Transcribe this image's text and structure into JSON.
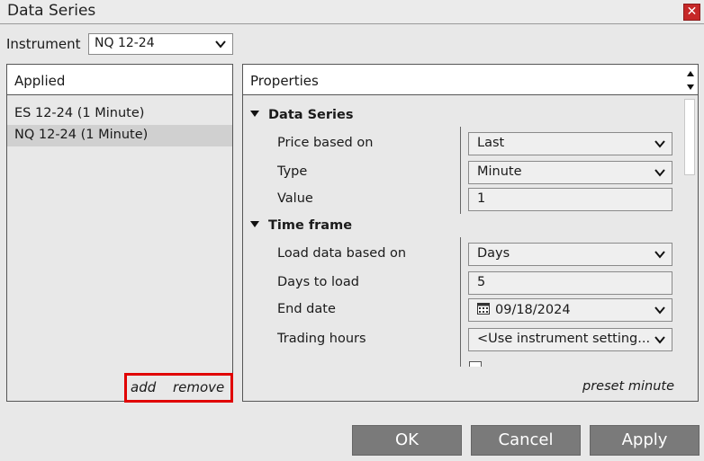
{
  "window": {
    "title": "Data Series"
  },
  "instrument": {
    "label": "Instrument",
    "value": "NQ 12-24"
  },
  "applied": {
    "header": "Applied",
    "items": [
      {
        "label": "ES 12-24 (1 Minute)",
        "selected": false
      },
      {
        "label": "NQ 12-24 (1 Minute)",
        "selected": true
      }
    ],
    "add_label": "add",
    "remove_label": "remove"
  },
  "properties": {
    "header": "Properties",
    "categories": [
      {
        "name": "Data Series",
        "rows": [
          {
            "label": "Price based on",
            "value": "Last",
            "kind": "dropdown"
          },
          {
            "label": "Type",
            "value": "Minute",
            "kind": "dropdown"
          },
          {
            "label": "Value",
            "value": "1",
            "kind": "text"
          }
        ]
      },
      {
        "name": "Time frame",
        "rows": [
          {
            "label": "Load data based on",
            "value": "Days",
            "kind": "dropdown"
          },
          {
            "label": "Days to load",
            "value": "5",
            "kind": "text"
          },
          {
            "label": "End date",
            "value": "09/18/2024",
            "kind": "date"
          },
          {
            "label": "Trading hours",
            "value": "<Use instrument setting...",
            "kind": "dropdown"
          }
        ]
      }
    ],
    "preset_label": "preset minute"
  },
  "buttons": {
    "ok": "OK",
    "cancel": "Cancel",
    "apply": "Apply"
  },
  "colors": {
    "close": "#c62828",
    "highlight_border": "#e00000",
    "button_bg": "#7a7a7a",
    "selected_row": "#d0d0d0"
  }
}
